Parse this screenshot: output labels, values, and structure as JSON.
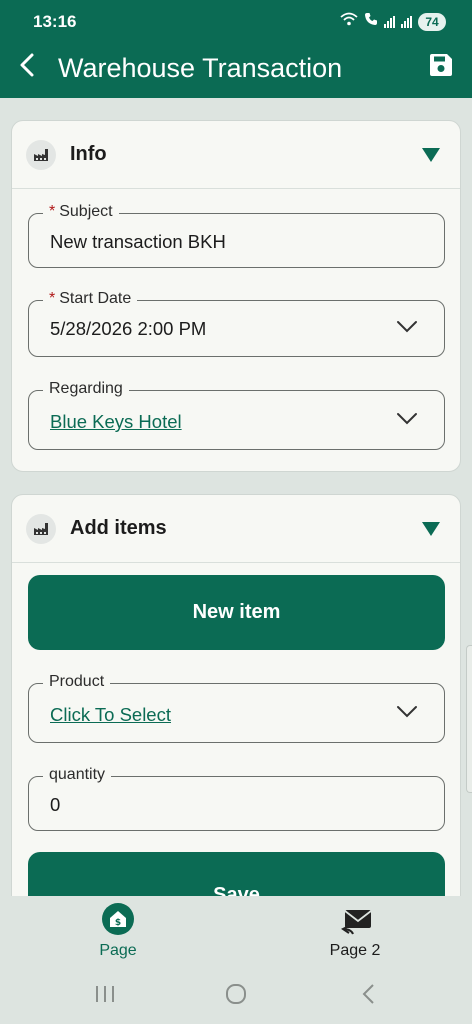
{
  "status_bar": {
    "time": "13:16",
    "battery": "74"
  },
  "header": {
    "title": "Warehouse Transaction"
  },
  "info_section": {
    "title": "Info",
    "subject": {
      "label": "Subject",
      "value": "New transaction BKH"
    },
    "start_date": {
      "label": "Start Date",
      "value": "5/28/2026 2:00 PM"
    },
    "regarding": {
      "label": "Regarding",
      "value": "Blue Keys Hotel"
    }
  },
  "items_section": {
    "title": "Add items",
    "new_item_button": "New item",
    "product": {
      "label": "Product",
      "value": "Click To Select"
    },
    "quantity": {
      "label": "quantity",
      "value": "0"
    },
    "save_button": "Save"
  },
  "bottom_nav": {
    "items": [
      {
        "label": "Page",
        "active": true
      },
      {
        "label": "Page 2",
        "active": false
      }
    ]
  },
  "colors": {
    "primary": "#0b6b54",
    "background": "#dde4e0",
    "required": "#b01818"
  }
}
